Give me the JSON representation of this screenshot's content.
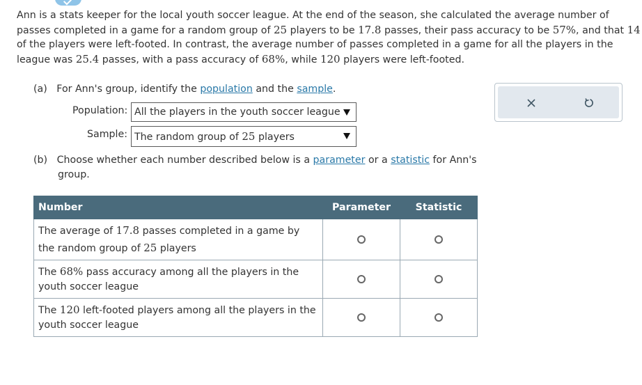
{
  "intro": {
    "p1": "Ann is a stats keeper for the local youth soccer league. At the end of the season, she calculated the average number of passes completed in a game for a random group of ",
    "n_group": "25",
    "p2": " players to be ",
    "avg_group": "17.8",
    "p3": " passes, their pass accuracy to be ",
    "acc_group": "57%",
    "p4": ", and that ",
    "left_group": "14",
    "p5": " of the players were left-footed. In contrast, the average number of passes completed in a game for all the players in the league was ",
    "avg_all": "25.4",
    "p6": " passes, with a pass accuracy of ",
    "acc_all": "68%",
    "p7": ", while ",
    "left_all": "120",
    "p8": " players were left-footed."
  },
  "part_a": {
    "marker": "(a)",
    "text_before": "For Ann's group, identify the ",
    "link_population": "population",
    "text_mid": " and the ",
    "link_sample": "sample",
    "text_end": ".",
    "population_label": "Population:",
    "population_value": "All the players in the youth soccer league",
    "sample_label": "Sample:",
    "sample_value_prefix": "The random group of ",
    "sample_value_num": "25",
    "sample_value_suffix": " players"
  },
  "part_b": {
    "marker": "(b)",
    "text_before": "Choose whether each number described below is a ",
    "link_parameter": "parameter",
    "text_mid": " or a ",
    "link_statistic": "statistic",
    "text_end": " for Ann's",
    "text_line2": "group."
  },
  "table": {
    "headers": [
      "Number",
      "Parameter",
      "Statistic"
    ],
    "rows": [
      {
        "t1": "The average of ",
        "n1": "17.8",
        "t2": " passes completed in a game by the random group of ",
        "n2": "25",
        "t3": " players"
      },
      {
        "t1": "The ",
        "n1": "68%",
        "t2": " pass accuracy among all the players in the youth soccer league",
        "n2": "",
        "t3": ""
      },
      {
        "t1": "The ",
        "n1": "120",
        "t2": " left-footed players among all the players in the youth soccer league",
        "n2": "",
        "t3": ""
      }
    ]
  },
  "toolbox": {
    "close_icon": "x-icon",
    "reset_icon": "undo-icon"
  },
  "colors": {
    "link": "#2a79a8",
    "header_bg": "#4a6b7c",
    "tab": "#8fc4e8",
    "toolbox_bg": "#e2e8ee"
  }
}
